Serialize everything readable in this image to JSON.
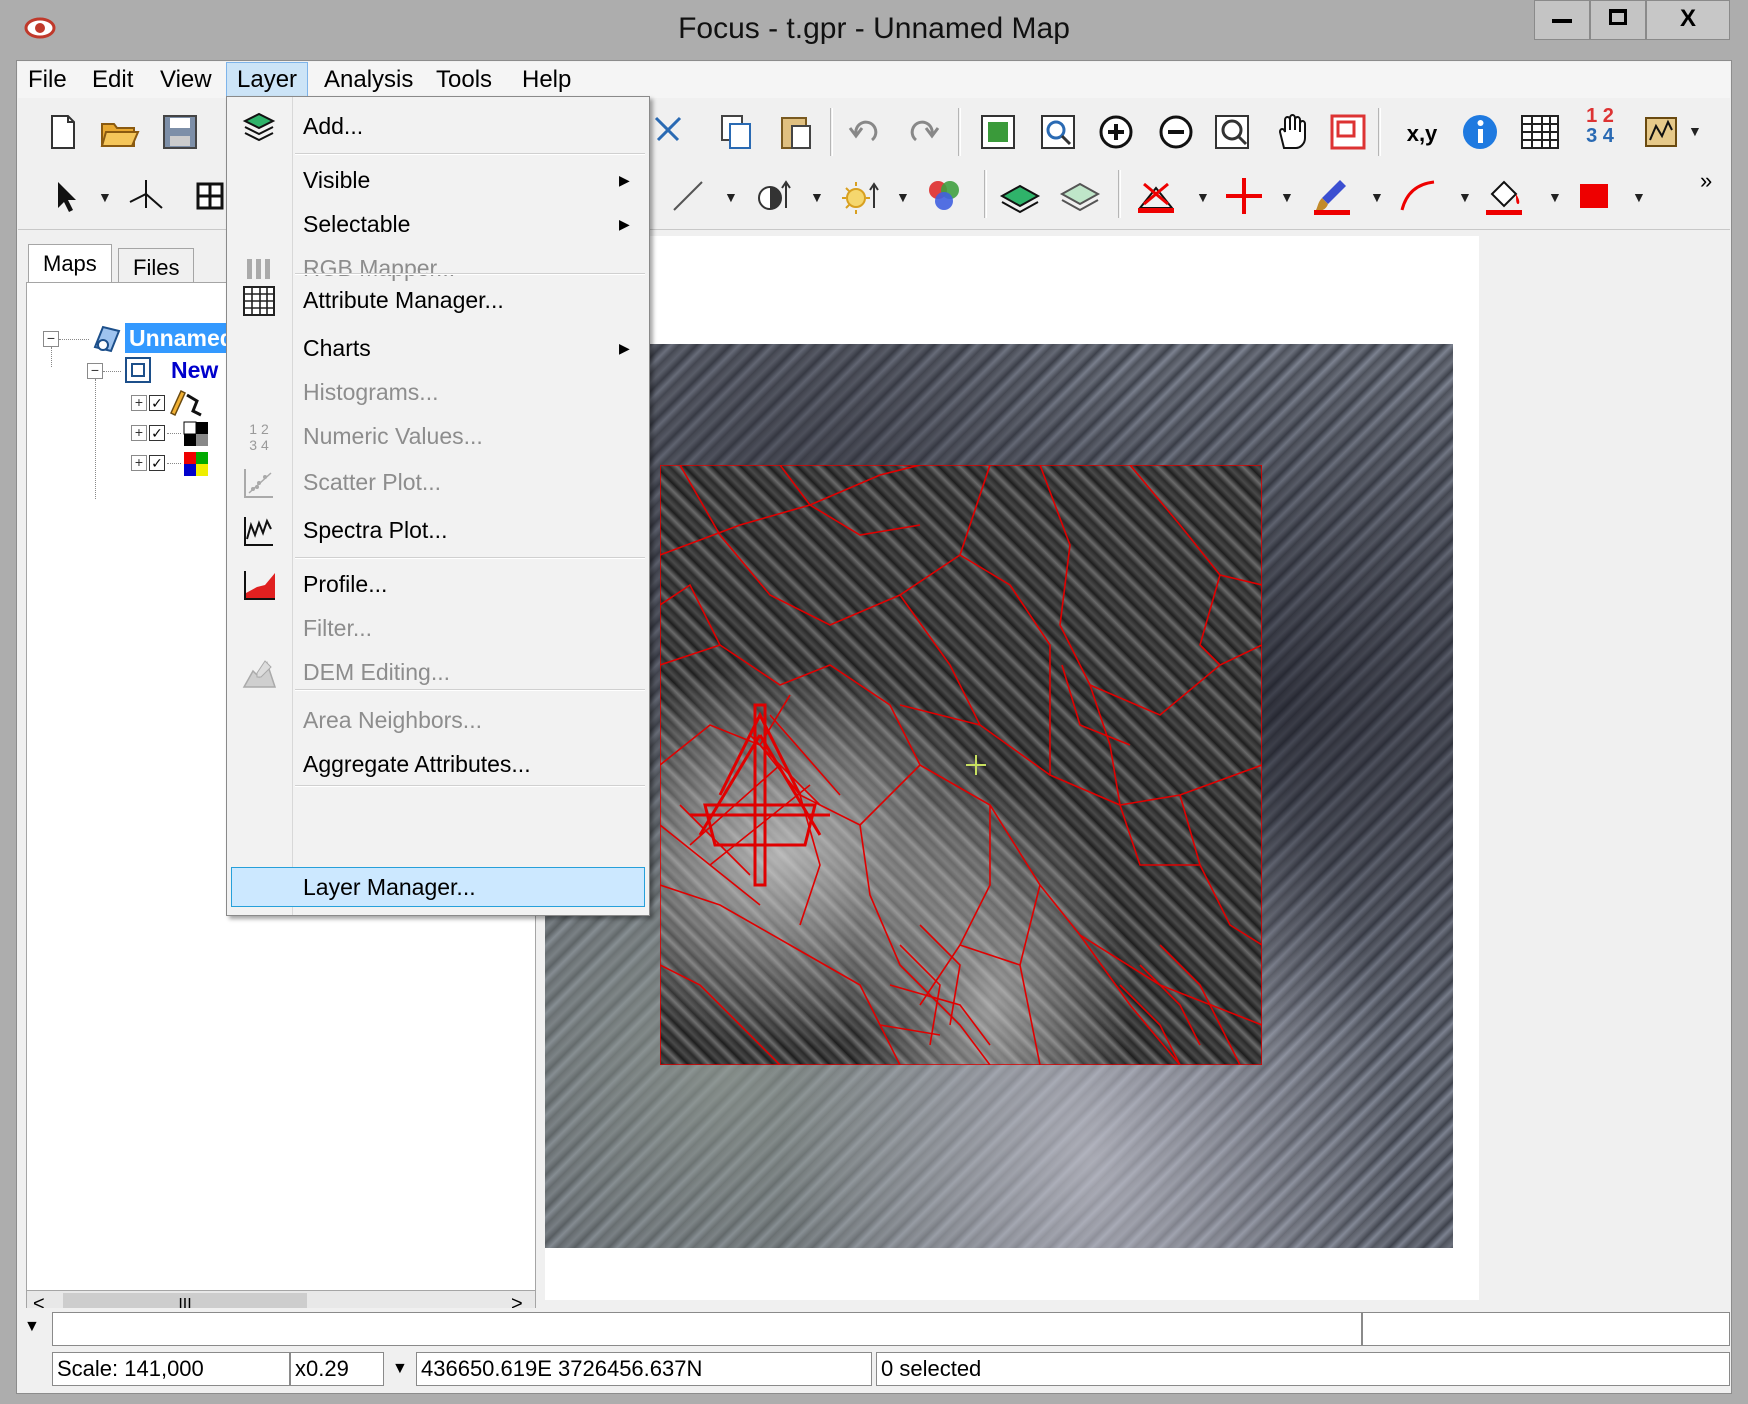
{
  "window": {
    "title": "Focus - t.gpr - Unnamed Map",
    "min_glyph": "▁",
    "max_glyph": "□",
    "close_glyph": "X"
  },
  "menubar": {
    "items": [
      "File",
      "Edit",
      "View",
      "Layer",
      "Analysis",
      "Tools",
      "Help"
    ]
  },
  "layer_menu": {
    "items": [
      {
        "label": "Add...",
        "enabled": true,
        "submenu": false,
        "icon": "layers-stack-icon"
      },
      {
        "label": "Visible",
        "enabled": true,
        "submenu": true,
        "icon": ""
      },
      {
        "label": "Selectable",
        "enabled": true,
        "submenu": true,
        "icon": ""
      },
      {
        "label": "RGB Mapper...",
        "enabled": false,
        "submenu": false,
        "icon": "rgb-bars-icon"
      },
      {
        "label": "Attribute Manager...",
        "enabled": true,
        "submenu": false,
        "icon": "table-grid-icon"
      },
      {
        "label": "Charts",
        "enabled": true,
        "submenu": true,
        "icon": ""
      },
      {
        "label": "Histograms...",
        "enabled": false,
        "submenu": false,
        "icon": ""
      },
      {
        "label": "Numeric Values...",
        "enabled": false,
        "submenu": false,
        "icon": "numeric-grid-icon"
      },
      {
        "label": "Scatter Plot...",
        "enabled": false,
        "submenu": false,
        "icon": "scatter-plot-icon"
      },
      {
        "label": "Spectra Plot...",
        "enabled": true,
        "submenu": false,
        "icon": "spectra-plot-icon"
      },
      {
        "label": "Profile...",
        "enabled": true,
        "submenu": false,
        "icon": "profile-chart-icon"
      },
      {
        "label": "Filter...",
        "enabled": false,
        "submenu": false,
        "icon": ""
      },
      {
        "label": "DEM Editing...",
        "enabled": false,
        "submenu": false,
        "icon": "dem-editing-icon"
      },
      {
        "label": "Area Neighbors...",
        "enabled": false,
        "submenu": false,
        "icon": ""
      },
      {
        "label": "Aggregate Attributes...",
        "enabled": true,
        "submenu": false,
        "icon": ""
      },
      {
        "label": "Layer Manager...",
        "enabled": true,
        "submenu": false,
        "icon": "",
        "highlighted": true
      }
    ]
  },
  "toolbar": {
    "xy_label": "x,y",
    "numbers_top": "1 2",
    "numbers_bottom": "3 4",
    "overflow": "»"
  },
  "left_panel": {
    "tabs": [
      "Maps",
      "Files"
    ],
    "tree": {
      "root_label": "Unnamed",
      "child_label": "New"
    },
    "scrollbar": {
      "left": "<",
      "thumb": "III",
      "right": ">"
    }
  },
  "status": {
    "scale": "Scale: 141,000",
    "zoom": "x0.29",
    "coords": "436650.619E 3726456.637N",
    "selected": "0 selected"
  },
  "colors": {
    "accent": "#3399ff",
    "menu_highlight": "#cce8ff",
    "vector_red": "#e00000",
    "chrome": "#adadad"
  }
}
